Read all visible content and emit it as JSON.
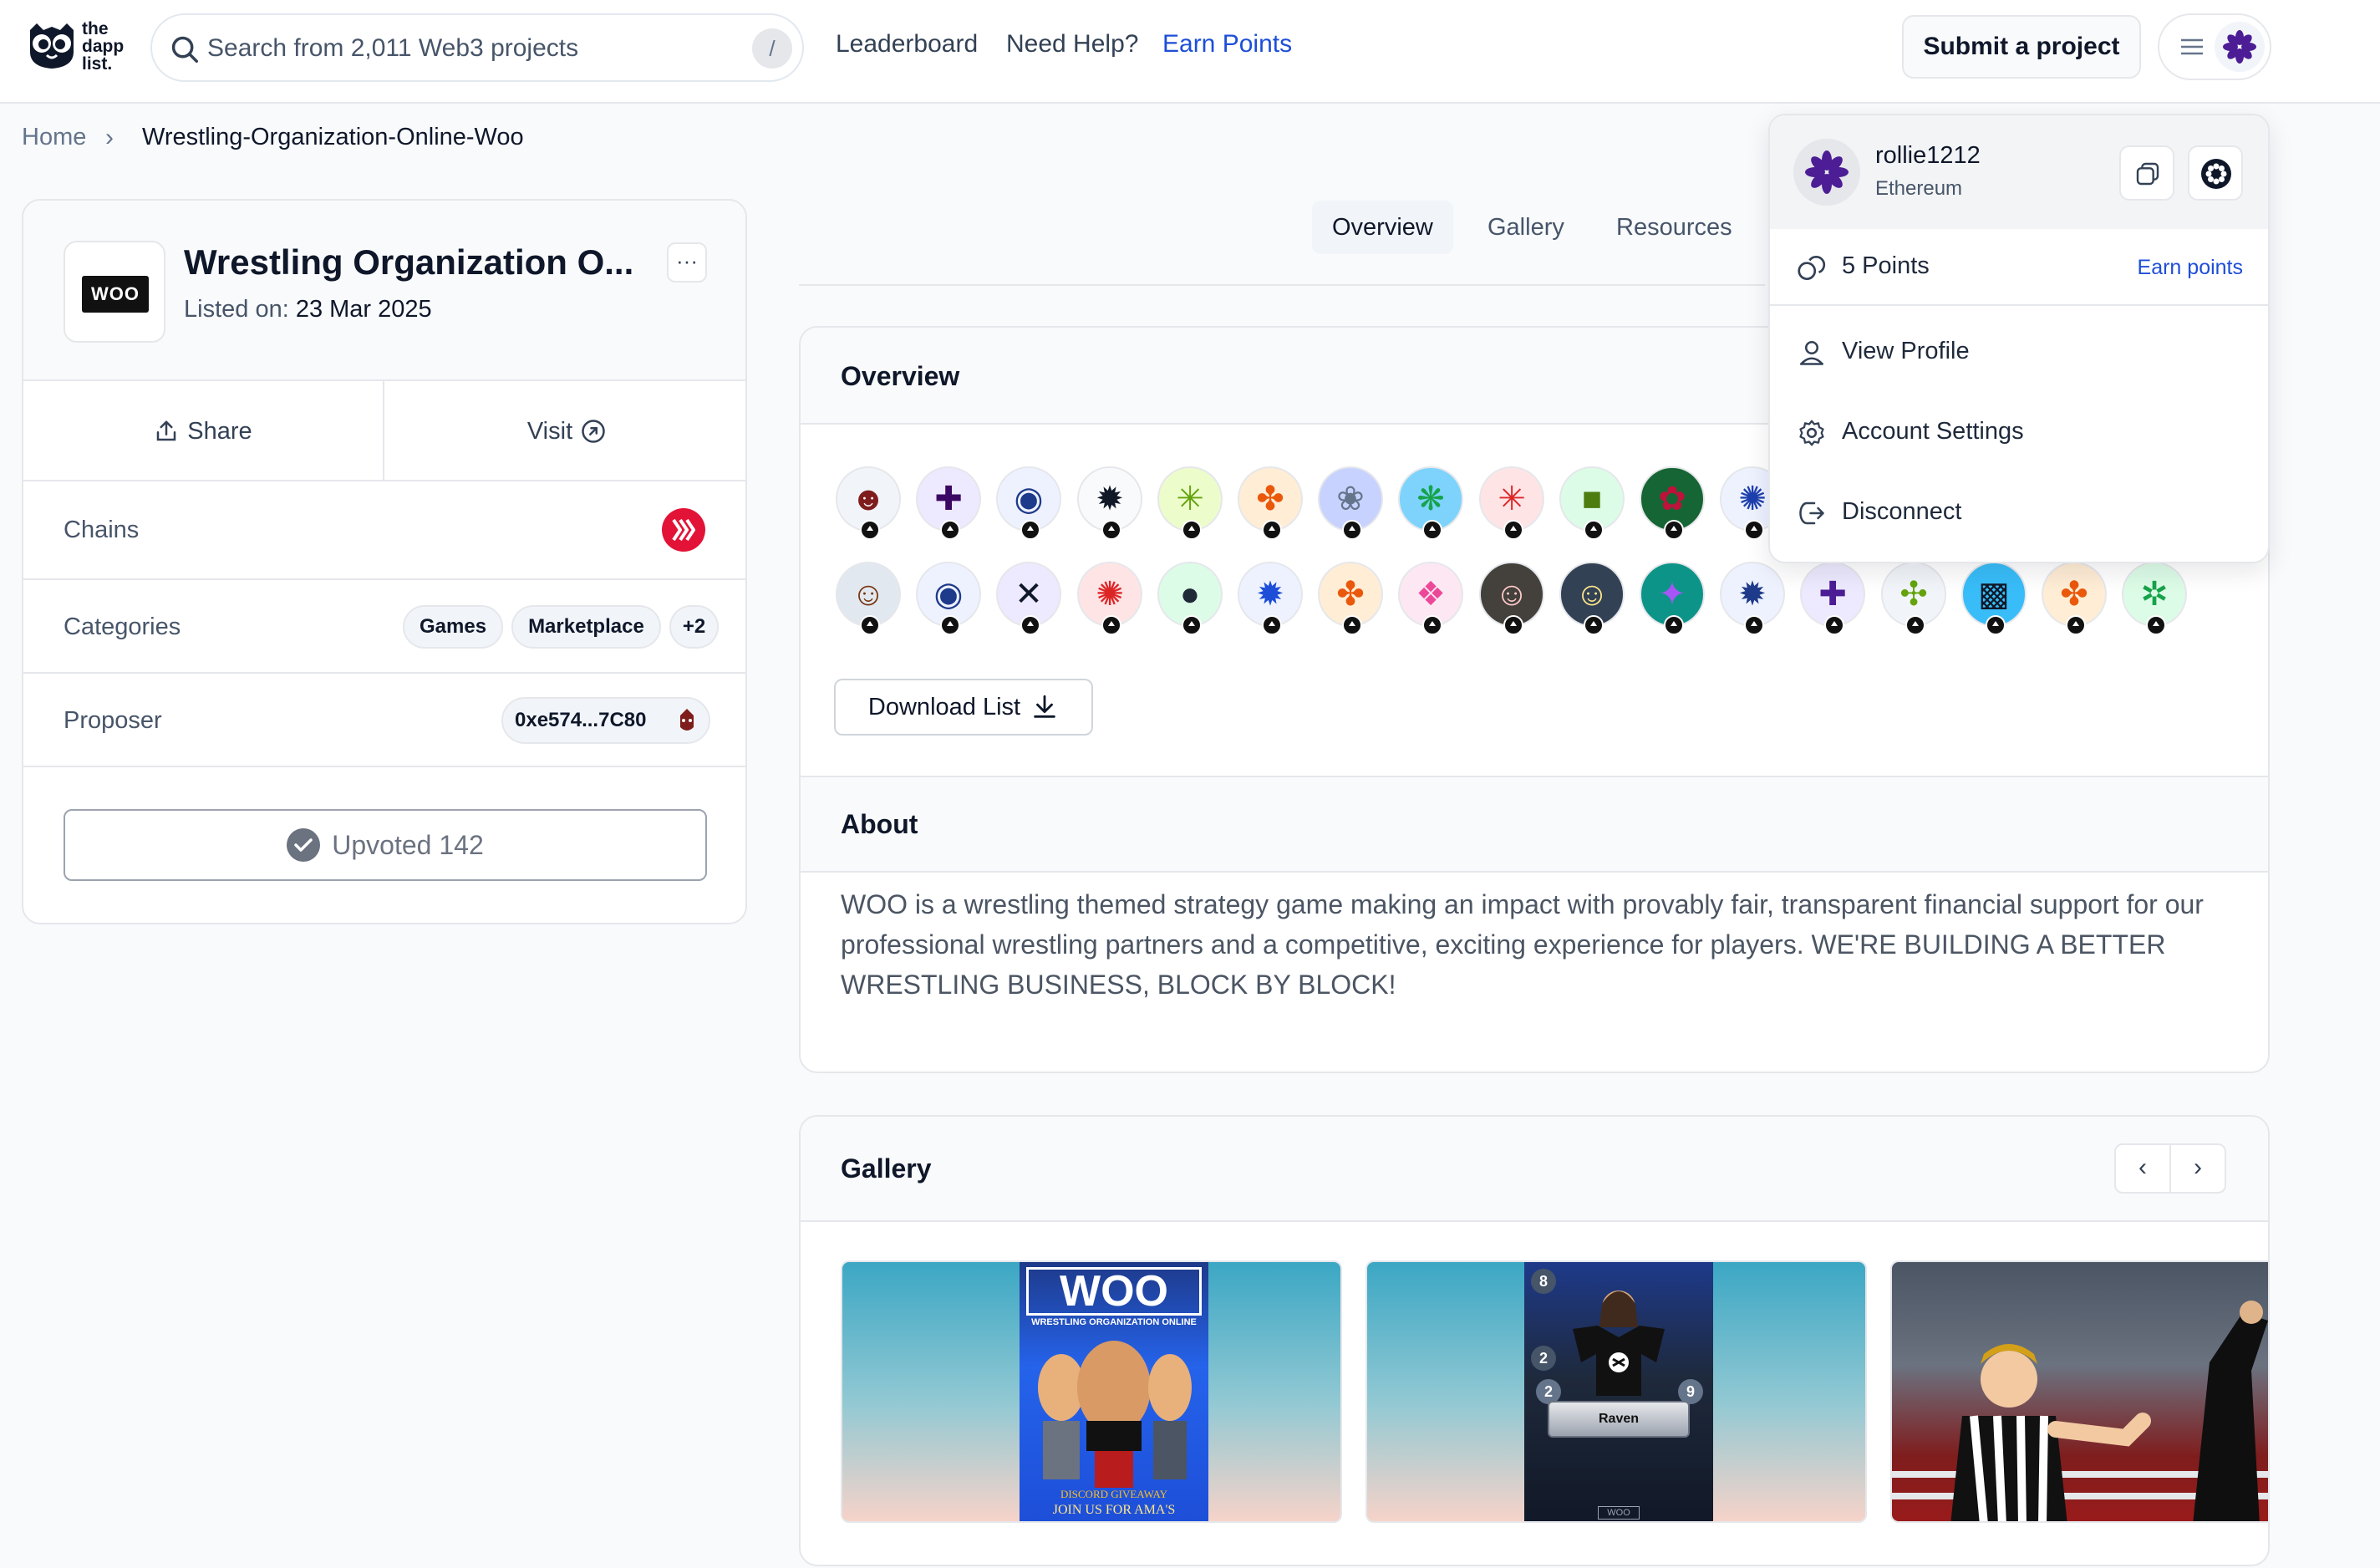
{
  "header": {
    "logo_text": [
      "the",
      "dapp",
      "list."
    ],
    "search_placeholder": "Search from 2,011 Web3 projects",
    "search_shortcut": "/",
    "nav": [
      {
        "label": "Leaderboard"
      },
      {
        "label": "Need Help?"
      },
      {
        "label": "Earn Points"
      }
    ],
    "submit_label": "Submit a project",
    "accent": "#1d4ed8"
  },
  "breadcrumb": {
    "home": "Home",
    "separator": "›",
    "current": "Wrestling-Organization-Online-Woo"
  },
  "project": {
    "logo_text": "WOO",
    "title": "Wrestling Organization O...",
    "listed_label": "Listed on:",
    "listed_date": "23 Mar 2025",
    "more_label": "···",
    "share_label": "Share",
    "visit_label": "Visit",
    "chains_label": "Chains",
    "chain_icon": "hive-chain-icon",
    "chain_color": "#e31337",
    "categories_label": "Categories",
    "categories": [
      "Games",
      "Marketplace",
      "+2"
    ],
    "proposer_label": "Proposer",
    "proposer_address": "0xe574...7C80",
    "upvote_label": "Upvoted 142"
  },
  "tabs": [
    {
      "label": "Overview",
      "active": true
    },
    {
      "label": "Gallery",
      "active": false
    },
    {
      "label": "Resources",
      "active": false
    }
  ],
  "overview": {
    "title": "Overview",
    "download_label": "Download List",
    "upvoters_row1": [
      {
        "bg": "#f1f5f9",
        "glyph": "☻",
        "color": "#7f1d1d"
      },
      {
        "bg": "#ede9fe",
        "glyph": "✚",
        "color": "#3b0764"
      },
      {
        "bg": "#eef2ff",
        "glyph": "◉",
        "color": "#1e3a8a"
      },
      {
        "bg": "#f8fafc",
        "glyph": "✹",
        "color": "#111827"
      },
      {
        "bg": "#ecfccb",
        "glyph": "✳",
        "color": "#65a30d"
      },
      {
        "bg": "#ffedd5",
        "glyph": "✤",
        "color": "#ea580c"
      },
      {
        "bg": "#c7d2fe",
        "glyph": "❀",
        "color": "#64748b"
      },
      {
        "bg": "#7dd3fc",
        "glyph": "❋",
        "color": "#16a34a"
      },
      {
        "bg": "#ffe4e6",
        "glyph": "✳",
        "color": "#dc2626"
      },
      {
        "bg": "#dcfce7",
        "glyph": "■",
        "color": "#4d7c0f"
      },
      {
        "bg": "#166534",
        "glyph": "✿",
        "color": "#be123c"
      },
      {
        "bg": "#eef2ff",
        "glyph": "✺",
        "color": "#1e40af"
      }
    ],
    "upvoters_row2": [
      {
        "bg": "#e2e8f0",
        "glyph": "☺",
        "color": "#78350f"
      },
      {
        "bg": "#eef2ff",
        "glyph": "◉",
        "color": "#1e3a8a"
      },
      {
        "bg": "#ede9fe",
        "glyph": "✕",
        "color": "#0f172a"
      },
      {
        "bg": "#ffe4e6",
        "glyph": "✺",
        "color": "#dc2626"
      },
      {
        "bg": "#dcfce7",
        "glyph": "●",
        "color": "#1f2937"
      },
      {
        "bg": "#eef2ff",
        "glyph": "✹",
        "color": "#1d4ed8"
      },
      {
        "bg": "#ffedd5",
        "glyph": "✤",
        "color": "#ea580c"
      },
      {
        "bg": "#fce7f3",
        "glyph": "❖",
        "color": "#ec4899"
      },
      {
        "bg": "#44403c",
        "glyph": "☺",
        "color": "#fecaca"
      },
      {
        "bg": "#334155",
        "glyph": "☺",
        "color": "#fde68a"
      },
      {
        "bg": "#0d9488",
        "glyph": "✦",
        "color": "#a855f7"
      },
      {
        "bg": "#eef2ff",
        "glyph": "✹",
        "color": "#1e3a8a"
      },
      {
        "bg": "#ede9fe",
        "glyph": "✚",
        "color": "#4c1d95"
      },
      {
        "bg": "#f1f5f9",
        "glyph": "✣",
        "color": "#65a30d"
      },
      {
        "bg": "#38bdf8",
        "glyph": "▩",
        "color": "#111827"
      },
      {
        "bg": "#ffedd5",
        "glyph": "✤",
        "color": "#ea580c"
      },
      {
        "bg": "#dcfce7",
        "glyph": "✲",
        "color": "#16a34a"
      }
    ]
  },
  "about": {
    "title": "About",
    "text": "WOO is a wrestling themed strategy game making an impact with provably fair, transparent financial support for our professional wrestling partners and a competitive, exciting experience for players. WE'RE BUILDING A BETTER WRESTLING BUSINESS, BLOCK BY BLOCK!"
  },
  "gallery": {
    "title": "Gallery",
    "prev": "‹",
    "next": "›",
    "image1": {
      "title": "WOO",
      "subtitle": "WRESTLING ORGANIZATION ONLINE",
      "caption1": "DISCORD GIVEAWAY",
      "caption2": "JOIN US FOR AMA'S"
    },
    "image2": {
      "name": "Raven",
      "num_top": "8",
      "num_mid": "2",
      "num_left": "2",
      "num_right": "9",
      "footer": "WOO"
    }
  },
  "dropdown": {
    "username": "rollie1212",
    "network": "Ethereum",
    "points": "5 Points",
    "earn_points": "Earn points",
    "items": [
      {
        "label": "View Profile"
      },
      {
        "label": "Account Settings"
      },
      {
        "label": "Disconnect"
      }
    ]
  }
}
